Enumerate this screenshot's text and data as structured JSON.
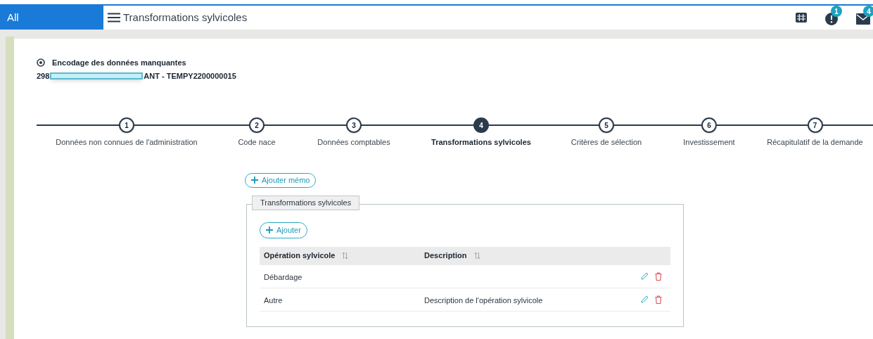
{
  "topbar": {
    "scope": "All",
    "title": "Transformations sylvicoles",
    "alerts_badge": "1",
    "messages_badge": "4"
  },
  "header": {
    "title": "Encodage des données manquantes",
    "id_prefix": "298",
    "id_suffix": "ANT - TEMPY2200000015"
  },
  "steps": [
    {
      "number": "1",
      "label": "Données non connues de l'administration",
      "selected": false
    },
    {
      "number": "2",
      "label": "Code nace",
      "selected": false
    },
    {
      "number": "3",
      "label": "Données comptables",
      "selected": false
    },
    {
      "number": "4",
      "label": "Transformations sylvicoles",
      "selected": true
    },
    {
      "number": "5",
      "label": "Critères de sélection",
      "selected": false
    },
    {
      "number": "6",
      "label": "Investissement",
      "selected": false
    },
    {
      "number": "7",
      "label": "Récapitulatif de la demande",
      "selected": false
    }
  ],
  "memo_button": "Ajouter mémo",
  "section": {
    "legend": "Transformations sylvicoles",
    "add_button": "Ajouter",
    "columns": [
      "Opération sylvicole",
      "Description"
    ],
    "rows": [
      {
        "operation": "Débardage"
      },
      {
        "operation": "Autre",
        "description": "Description de l'opération sylvicole"
      }
    ]
  }
}
